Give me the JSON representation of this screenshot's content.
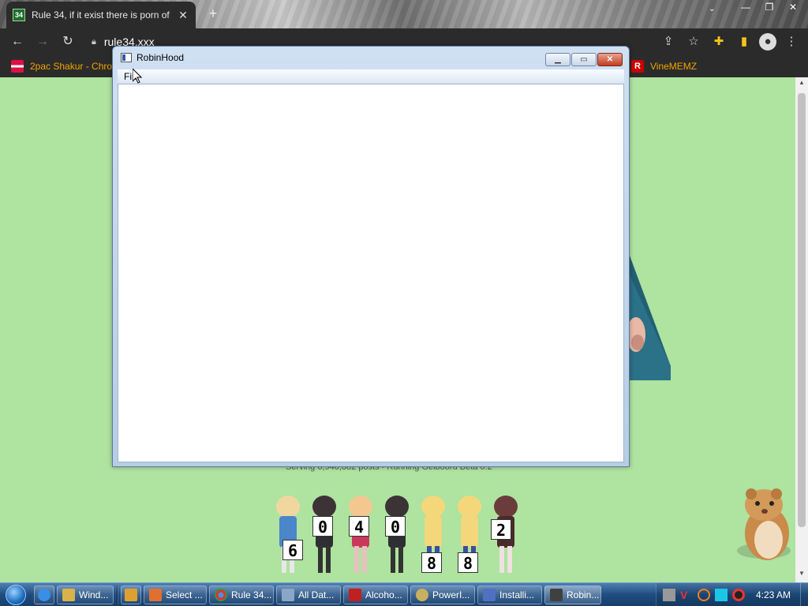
{
  "browser": {
    "tab_title": "Rule 34, if it exist there is porn of",
    "tab_favicon": "34",
    "url": "rule34.xxx",
    "bookmarks": [
      {
        "label": "2pac Shakur - Chro...",
        "icon": "bookmark-favicon"
      },
      {
        "label": "VineMEMZ",
        "icon": "r-logo"
      }
    ]
  },
  "page": {
    "serving_text": "Serving 6,940,882 posts - Running Gelbooru Beta 0.2",
    "counter_digits": [
      "6",
      "0",
      "4",
      "0",
      "8",
      "8",
      "2"
    ]
  },
  "dialog": {
    "title": "RobinHood",
    "menu": [
      "File"
    ]
  },
  "taskbar": {
    "items": [
      {
        "label": "Wind...",
        "color": "#d8b24a"
      },
      {
        "label": "",
        "color": "#e0a030"
      },
      {
        "label": "Select ...",
        "color": "#e07030"
      },
      {
        "label": "Rule 34...",
        "color": "#3c8e3c"
      },
      {
        "label": "All Dat...",
        "color": "#8aa7c8"
      },
      {
        "label": "Alcoho...",
        "color": "#c02020"
      },
      {
        "label": "PowerI...",
        "color": "#c9b060"
      },
      {
        "label": "Installi...",
        "color": "#5070c0"
      },
      {
        "label": "Robin...",
        "color": "#404040"
      }
    ],
    "clock": "4:23 AM"
  }
}
